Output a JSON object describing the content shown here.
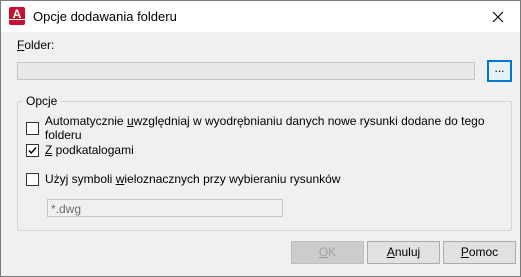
{
  "window": {
    "title": "Opcje dodawania folderu",
    "app_icon": "autocad-icon"
  },
  "folder": {
    "label_u": "F",
    "label_rest": "older:",
    "value": "",
    "browse_label": "..."
  },
  "options": {
    "legend": "Opcje",
    "auto_include": {
      "checked": false,
      "pre": "Automatycznie ",
      "u": "u",
      "post": "względniaj w wyodrębnianiu danych nowe rysunki dodane do tego folderu"
    },
    "subfolders": {
      "checked": true,
      "u": "Z",
      "post": " podkatalogami"
    },
    "wildcards": {
      "checked": false,
      "pre": "Użyj symboli ",
      "u": "w",
      "post": "ieloznacznych przy wybieraniu rysunków"
    },
    "mask_value": "*.dwg"
  },
  "buttons": {
    "ok": "OK",
    "cancel": "Anuluj",
    "help": "Pomoc"
  }
}
